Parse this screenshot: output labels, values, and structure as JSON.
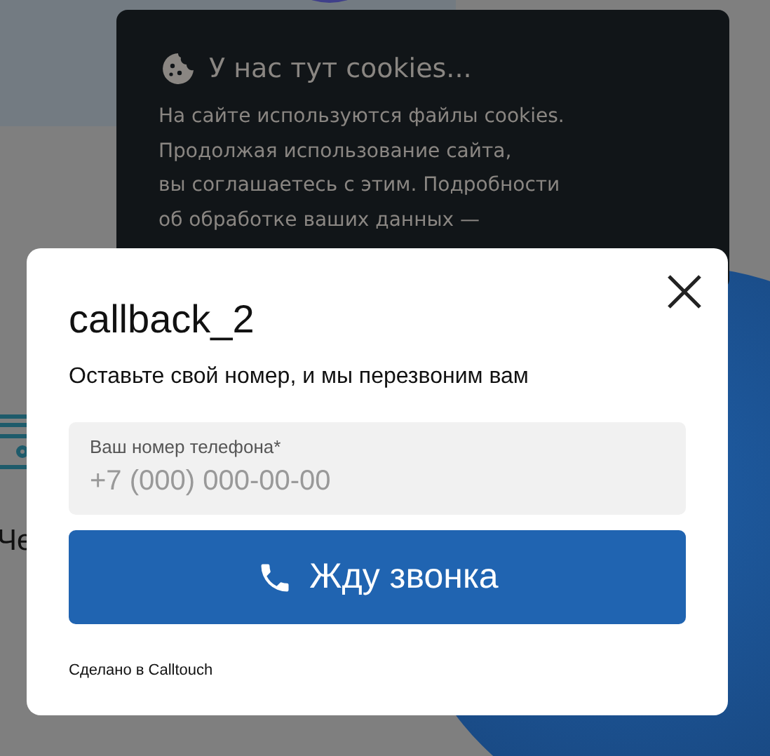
{
  "background": {
    "partial_text": "Че"
  },
  "cookie_notice": {
    "title": "У нас тут cookies...",
    "lines": [
      "На сайте используются файлы cookies.",
      "Продолжая использование сайта,",
      "вы соглашаетесь с этим. Подробности",
      "об обработке ваших данных —"
    ]
  },
  "dialog": {
    "title": "callback_2",
    "subtitle": "Оставьте свой номер, и мы перезвоним вам",
    "phone_field": {
      "label": "Ваш номер телефона*",
      "placeholder": "+7 (000) 000-00-00"
    },
    "button": "Жду звонка",
    "footer": "Сделано в Calltouch"
  }
}
